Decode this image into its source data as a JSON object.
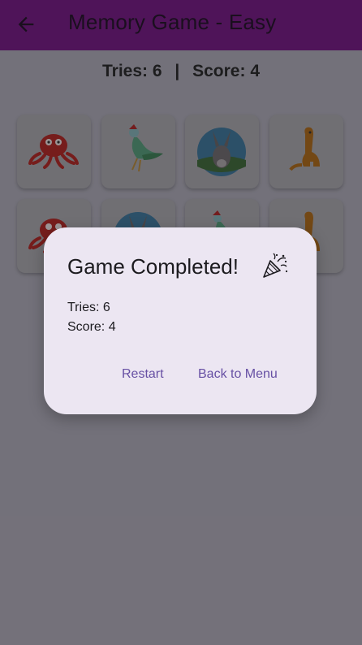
{
  "app": {
    "title": "Memory Game - Easy",
    "colors": {
      "appbar": "#4f1459",
      "dialog": "#ece6f2",
      "accent": "#6750a4"
    }
  },
  "status": {
    "tries_label": "Tries: 6",
    "separator": "|",
    "score_label": "Score: 4"
  },
  "cards": [
    {
      "name": "octopus",
      "face_up": true
    },
    {
      "name": "bird",
      "face_up": true
    },
    {
      "name": "donkey",
      "face_up": true
    },
    {
      "name": "dinosaur",
      "face_up": true
    },
    {
      "name": "octopus",
      "face_up": true
    },
    {
      "name": "donkey",
      "face_up": true
    },
    {
      "name": "bird",
      "face_up": true
    },
    {
      "name": "dinosaur",
      "face_up": true
    }
  ],
  "dialog": {
    "title": "Game Completed!",
    "title_icon": "party-popper-icon",
    "tries": "Tries: 6",
    "score": "Score: 4",
    "restart_label": "Restart",
    "menu_label": "Back to Menu"
  }
}
